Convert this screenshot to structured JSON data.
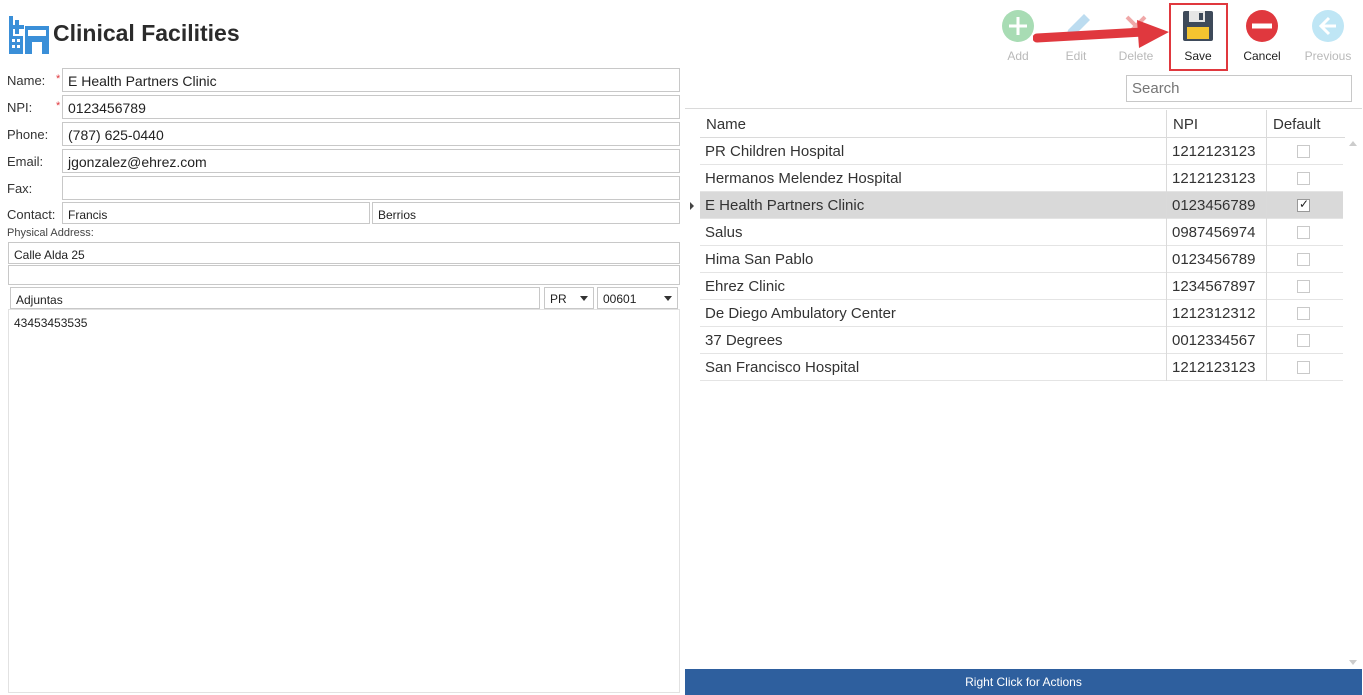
{
  "header": {
    "title": "Clinical Facilities",
    "icon": "hospital-icon"
  },
  "toolbar": {
    "add": {
      "label": "Add",
      "icon": "plus-circle-icon",
      "enabled": false
    },
    "edit": {
      "label": "Edit",
      "icon": "pencil-icon",
      "enabled": false
    },
    "delete": {
      "label": "Delete",
      "icon": "x-icon",
      "enabled": false
    },
    "save": {
      "label": "Save",
      "icon": "floppy-disk-icon",
      "enabled": true
    },
    "cancel": {
      "label": "Cancel",
      "icon": "no-entry-icon",
      "enabled": true
    },
    "previous": {
      "label": "Previous",
      "icon": "arrow-left-circle-icon",
      "enabled": false
    }
  },
  "search": {
    "placeholder": "Search"
  },
  "form": {
    "name_label": "Name:",
    "name_value": "E Health Partners Clinic",
    "npi_label": "NPI:",
    "npi_value": "0123456789",
    "phone_label": "Phone:",
    "phone_value": "(787) 625-0440",
    "email_label": "Email:",
    "email_value": "jgonzalez@ehrez.com",
    "fax_label": "Fax:",
    "fax_value": "",
    "contact_label": "Contact:",
    "contact_first": "Francis",
    "contact_last": "Berrios",
    "address_label": "Physical Address:",
    "address_line1": "Calle Alda 25",
    "address_line2": "",
    "city": "Adjuntas",
    "state": "PR",
    "zip": "00601",
    "notes": "43453453535",
    "required_mark": "*"
  },
  "grid": {
    "columns": [
      "Name",
      "NPI",
      "Default"
    ],
    "rows": [
      {
        "name": "PR Children Hospital",
        "npi": "1212123123",
        "default": false
      },
      {
        "name": "Hermanos Melendez Hospital",
        "npi": "1212123123",
        "default": false
      },
      {
        "name": "E Health Partners Clinic",
        "npi": "0123456789",
        "default": true
      },
      {
        "name": "Salus",
        "npi": "0987456974",
        "default": false
      },
      {
        "name": "Hima San Pablo",
        "npi": "0123456789",
        "default": false
      },
      {
        "name": "Ehrez  Clinic",
        "npi": "1234567897",
        "default": false
      },
      {
        "name": "De Diego Ambulatory Center",
        "npi": "1212312312",
        "default": false
      },
      {
        "name": "37 Degrees",
        "npi": "0012334567",
        "default": false
      },
      {
        "name": "San Francisco Hospital",
        "npi": "1212123123",
        "default": false
      }
    ],
    "selected_index": 2
  },
  "status": {
    "text": "Right Click for Actions"
  },
  "colors": {
    "accent_blue": "#2e5f9e",
    "icon_blue": "#3a8fd8",
    "highlight_red": "#e0383e",
    "selected_row": "#d9d9d9"
  }
}
